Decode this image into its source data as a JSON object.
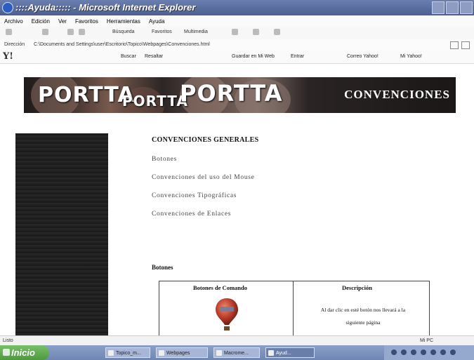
{
  "window": {
    "title": "::::Ayuda::::: - Microsoft Internet Explorer"
  },
  "menu": [
    "Archivo",
    "Edición",
    "Ver",
    "Favoritos",
    "Herramientas",
    "Ayuda"
  ],
  "toolbar": {
    "search": "Búsqueda",
    "favorites": "Favoritos",
    "multimedia": "Multimedia"
  },
  "address": {
    "label": "Dirección",
    "url": "C:\\Documents and Settings\\user\\Escritorio\\Topico\\Webpages\\Convenciones.html"
  },
  "yahoo": {
    "logo": "Y!",
    "buscar": "Buscar",
    "resaltar": "Resaltar",
    "guardar": "Guardar en Mi Web",
    "entrar": "Entrar",
    "correo": "Correo Yahoo!",
    "miyahoo": "Mi Yahoo!"
  },
  "banner": {
    "logo": "PORTTA",
    "heading": "CONVENCIONES"
  },
  "content": {
    "title": "CONVENCIONES GENERALES",
    "links": [
      "Botones",
      "Convenciones del uso del Mouse",
      "Convenciones Tipográficas",
      "Convenciones de Enlaces"
    ],
    "section_title": "Botones"
  },
  "table": {
    "col1_header": "Botones de Comando",
    "col2_header": "Descripción",
    "desc_line1": "Al dar clic en esté botón nos llevará a la",
    "desc_line2": "siguiente página"
  },
  "status": {
    "text": "Listo",
    "zone": "Mi PC"
  },
  "taskbar": {
    "start": "Inicio",
    "tasks": [
      "Topico_m...",
      "Webpages",
      "Macrome...",
      "Ayud..."
    ]
  },
  "colors": {
    "banner_dark": "#1f1a1a",
    "sidebar": "#222222",
    "taskbar": "#7b90bd",
    "start": "#5aa84a"
  }
}
